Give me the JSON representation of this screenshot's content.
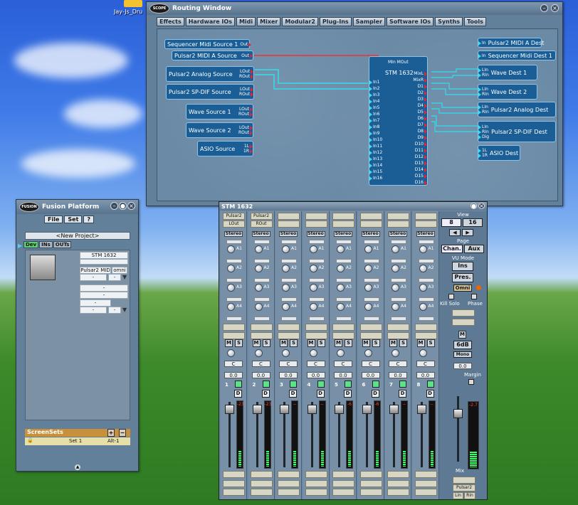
{
  "desktop": {
    "icon_label": "Jay-Js_Dru"
  },
  "routing": {
    "title": "Routing Window",
    "menu": [
      "Effects",
      "Hardware IOs",
      "Midi",
      "Mixer",
      "Modular2",
      "Plug-Ins",
      "Sampler",
      "Software IOs",
      "Synths",
      "Tools"
    ],
    "sources": [
      {
        "label": "Sequencer Midi Source 1",
        "ports": [
          "Out"
        ]
      },
      {
        "label": "Pulsar2 MIDI A Source",
        "ports": [
          "Out"
        ]
      },
      {
        "label": "Pulsar2 Analog Source",
        "ports": [
          "LOut",
          "ROut"
        ]
      },
      {
        "label": "Pulsar2 SP-DIF Source",
        "ports": [
          "LOut",
          "ROut"
        ]
      },
      {
        "label": "Wave Source 1",
        "ports": [
          "LOut",
          "ROut"
        ]
      },
      {
        "label": "Wave Source 2",
        "ports": [
          "LOut",
          "ROut"
        ]
      },
      {
        "label": "ASIO Source",
        "ports": [
          "1L",
          "1R"
        ]
      }
    ],
    "dests": [
      {
        "label": "Pulsar2 MIDI A Dest",
        "ports": [
          "In"
        ]
      },
      {
        "label": "Sequencer Midi Dest 1",
        "ports": [
          "In"
        ]
      },
      {
        "label": "Wave Dest 1",
        "ports": [
          "LIn",
          "RIn"
        ]
      },
      {
        "label": "Wave Dest 2",
        "ports": [
          "LIn",
          "RIn"
        ]
      },
      {
        "label": "Pulsar2 Analog Dest",
        "ports": [
          "LIn",
          "RIn"
        ]
      },
      {
        "label": "Pulsar2 SP-DIF Dest",
        "ports": [
          "LIn",
          "RIn",
          "Dig"
        ]
      },
      {
        "label": "ASIO Dest",
        "ports": [
          "1L",
          "1R"
        ]
      }
    ],
    "stm": {
      "label": "STM 1632",
      "midi": "MIn MOut",
      "inputs": [
        "In1",
        "In2",
        "In3",
        "In4",
        "In5",
        "In6",
        "In7",
        "In8",
        "In9",
        "In10",
        "In11",
        "In12",
        "In13",
        "In14",
        "In15",
        "In16"
      ],
      "outputs": [
        "MixL",
        "MixR",
        "D1",
        "D2",
        "D3",
        "D4",
        "D5",
        "D6",
        "D7",
        "D8",
        "D9",
        "D10",
        "D11",
        "D12",
        "D13",
        "D14",
        "D15",
        "D16"
      ]
    }
  },
  "fusion": {
    "title": "Fusion Platform",
    "menu": [
      "File",
      "Set",
      "?"
    ],
    "project": "<New Project>",
    "tabs": [
      "Dev",
      "INs",
      "OUTs"
    ],
    "device": {
      "name": "STM 1632",
      "midi": "Pulsar2 MID",
      "mode": "omni"
    },
    "empty": [
      "-",
      "-",
      "-",
      "-",
      "-",
      "-",
      "-"
    ],
    "screensets": {
      "title": "ScreenSets",
      "add": "+",
      "remove": "−",
      "set": "Set 1",
      "shortcut": "Alt-1"
    }
  },
  "mixer": {
    "title": "STM 1632",
    "channels": [
      {
        "num": "1",
        "src": [
          "Pulsar2",
          "LOut"
        ],
        "level": "-23"
      },
      {
        "num": "2",
        "src": [
          "Pulsar2",
          "ROut"
        ],
        "level": "-23"
      },
      {
        "num": "3",
        "src": [
          "",
          ""
        ],
        "level": "--"
      },
      {
        "num": "4",
        "src": [
          "",
          ""
        ],
        "level": "--"
      },
      {
        "num": "5",
        "src": [
          "",
          ""
        ],
        "level": "-6"
      },
      {
        "num": "6",
        "src": [
          "",
          ""
        ],
        "level": "-6"
      },
      {
        "num": "7",
        "src": [
          "",
          ""
        ],
        "level": "--"
      },
      {
        "num": "8",
        "src": [
          "",
          ""
        ],
        "level": "--"
      }
    ],
    "strip_labels": {
      "stereo": "Stereo",
      "aux": [
        "A1",
        "A2",
        "A3",
        "A4"
      ],
      "mute": "M",
      "solo": "S",
      "pan": "C",
      "value": "0.0",
      "dual": "D"
    },
    "control": {
      "view": "View",
      "v8": "8",
      "v16": "16",
      "page": "Page",
      "chan": "Chan.",
      "aux": "Aux",
      "vumode": "VU Mode",
      "ins": "Ins",
      "pres": "Pres.",
      "omni": "Omni",
      "killsolo": "Kill Solo",
      "phase": "Phase",
      "m": "M",
      "db": "6dB",
      "mono": "Mono",
      "value": "0.0",
      "margin": "Margin",
      "mix": "Mix",
      "master_level": "-2.7",
      "out": "Pulsar2",
      "lin": "Lin",
      "rin": "Rin"
    }
  }
}
